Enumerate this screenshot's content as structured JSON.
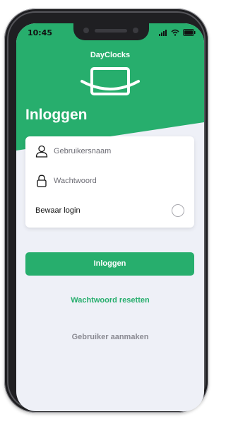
{
  "status_bar": {
    "time": "10:45"
  },
  "app": {
    "brand": "DayClocks",
    "title": "Inloggen"
  },
  "form": {
    "username_placeholder": "Gebruikersnaam",
    "username_value": "",
    "password_placeholder": "Wachtwoord",
    "password_value": "",
    "remember_label": "Bewaar login",
    "remember_checked": false
  },
  "actions": {
    "login_label": "Inloggen",
    "reset_password_label": "Wachtwoord resetten",
    "create_user_label": "Gebruiker aanmaken"
  },
  "colors": {
    "brand_green": "#27ae6d",
    "background": "#eef0f7",
    "muted_text": "#8a8a92"
  },
  "icons": [
    "user-icon",
    "lock-icon",
    "wifi-icon",
    "battery-icon",
    "signal-icon",
    "dayclocks-logo"
  ]
}
